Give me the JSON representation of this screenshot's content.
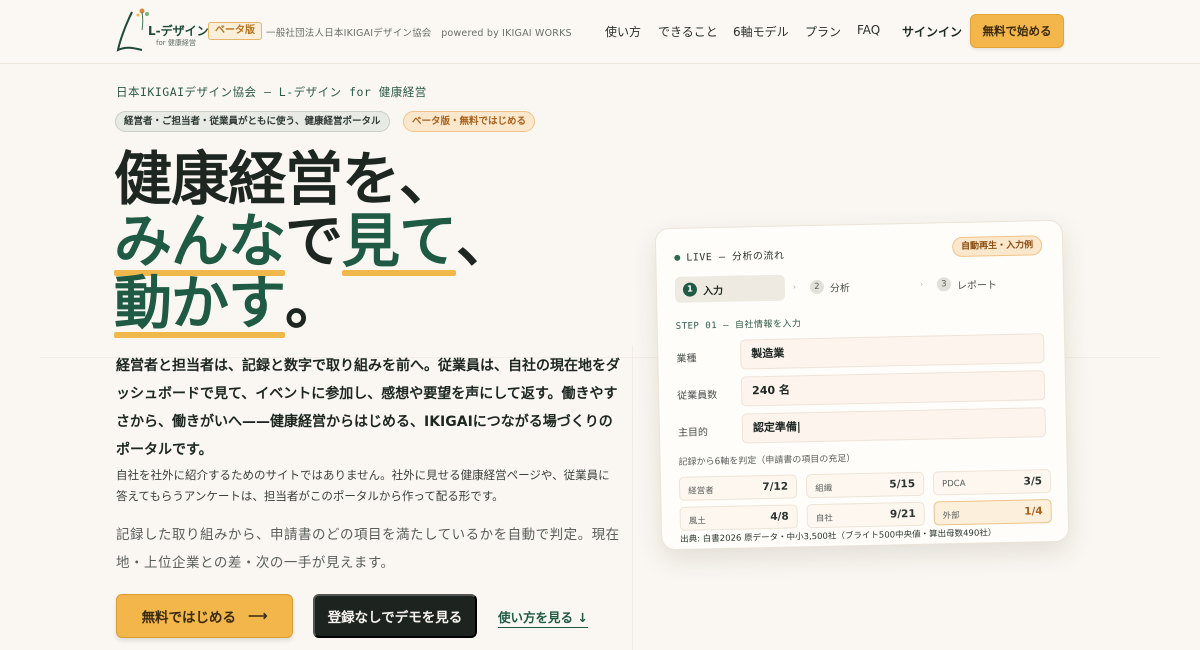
{
  "header": {
    "logo_text": "L-デザイン",
    "logo_sub": "for 健康経営",
    "beta_tag": "ベータ版",
    "org": "一般社団法人日本IKIGAIデザイン協会　powered by IKIGAI WORKS",
    "nav": [
      "使い方",
      "できること",
      "6軸モデル",
      "プラン",
      "FAQ"
    ],
    "signin": "サインイン",
    "cta": "無料で始める"
  },
  "hero": {
    "eyebrow": "日本IKIGAIデザイン協会 — L-デザイン for 健康経営",
    "pill_a": "経営者・ご担当者・従業員がともに使う、健康経営ポータル",
    "pill_b": "ベータ版・無料ではじめる",
    "headline_1": "健康経営を、",
    "headline_2a": "みんな",
    "headline_2b": "で",
    "headline_2c": "見て",
    "headline_2d": "、",
    "headline_3a": "動かす",
    "headline_3b": "。",
    "lead": "経営者と担当者は、記録と数字で取り組みを前へ。従業員は、自社の現在地をダッシュボードで見て、イベントに参加し、感想や要望を声にして返す。働きやすさから、働きがいへ——健康経営からはじめる、IKIGAIにつながる場づくりのポータルです。",
    "note": "自社を社外に紹介するためのサイトではありません。社外に見せる健康経営ページや、従業員に答えてもらうアンケートは、担当者がこのポータルから作って配る形です。",
    "note2": "記録した取り組みから、申請書のどの項目を満たしているかを自動で判定。現在地・上位企業との差・次の一手が見えます。",
    "btn_primary": "無料ではじめる",
    "btn_primary_arrow": "⟶",
    "btn_dark": "登録なしでデモを見る",
    "link_how": "使い方を見る ↓"
  },
  "demo": {
    "live": "LIVE — 分析の流れ",
    "autoplay": "自動再生・入力例",
    "steps": [
      {
        "num": "1",
        "label": "入力"
      },
      {
        "num": "2",
        "label": "分析"
      },
      {
        "num": "3",
        "label": "レポート"
      }
    ],
    "step_label": "STEP 01 — 自社情報を入力",
    "fields": [
      {
        "label": "業種",
        "value": "製造業"
      },
      {
        "label": "従業員数",
        "value": "240 名"
      },
      {
        "label": "主目的",
        "value": "認定準備|"
      }
    ],
    "judge_title": "記録から6軸を判定（申請書の項目の充足）",
    "axes": [
      {
        "name": "経営者",
        "value": "7/12"
      },
      {
        "name": "組織",
        "value": "5/15"
      },
      {
        "name": "PDCA",
        "value": "3/5"
      },
      {
        "name": "風土",
        "value": "4/8"
      },
      {
        "name": "自社",
        "value": "9/21"
      },
      {
        "name": "外部",
        "value": "1/4"
      }
    ],
    "source": "出典: 白書2026 原データ・中小3,500社（ブライト500中央値・算出母数490社）"
  },
  "colors": {
    "accent": "#f2b64a",
    "brand_green": "#1f5a44",
    "dark": "#1d2420",
    "background": "#faf7f2"
  }
}
